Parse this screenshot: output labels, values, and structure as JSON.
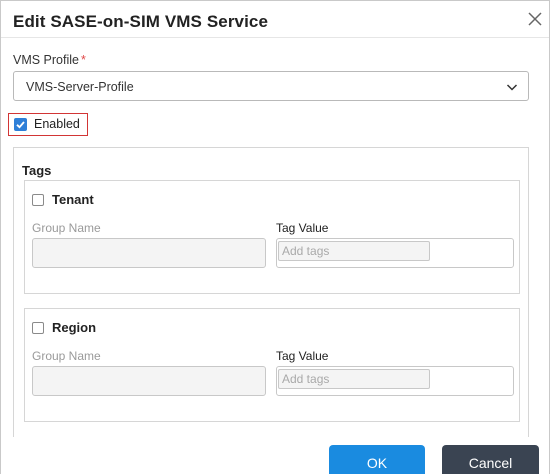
{
  "dialog": {
    "title": "Edit SASE-on-SIM VMS Service"
  },
  "vms_profile": {
    "label": "VMS Profile",
    "required_marker": "*",
    "value": "VMS-Server-Profile"
  },
  "enabled": {
    "label": "Enabled",
    "checked": true
  },
  "tags": {
    "title": "Tags",
    "groups": [
      {
        "title": "Tenant",
        "checked": false,
        "group_name_label": "Group Name",
        "group_name_value": "",
        "tag_value_label": "Tag Value",
        "tag_placeholder": "Add tags"
      },
      {
        "title": "Region",
        "checked": false,
        "group_name_label": "Group Name",
        "group_name_value": "",
        "tag_value_label": "Tag Value",
        "tag_placeholder": "Add tags"
      }
    ]
  },
  "footer": {
    "ok_label": "OK",
    "cancel_label": "Cancel"
  },
  "colors": {
    "primary": "#1a8be0",
    "secondary": "#3a4452",
    "highlight_border": "#d23535",
    "required": "#e04848"
  }
}
